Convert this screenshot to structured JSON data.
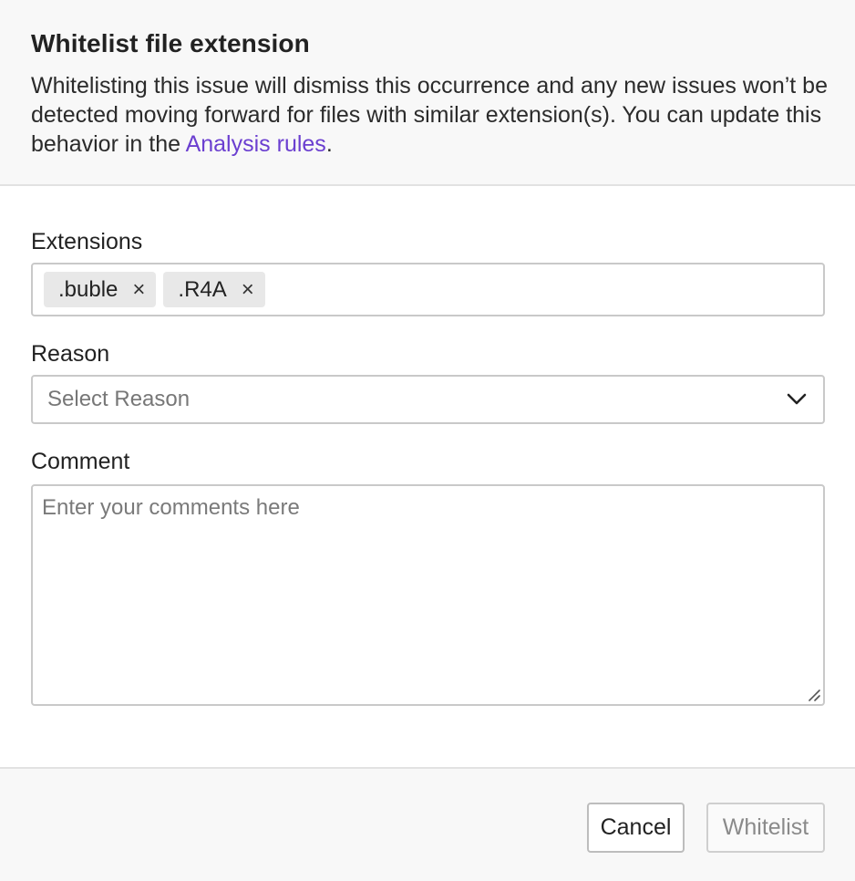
{
  "header": {
    "title": "Whitelist file extension",
    "description_before_link": "Whitelisting this issue will dismiss this occurrence and any new issues won’t be detected moving forward for files with similar extension(s). You can update this behavior in the ",
    "link_text": "Analysis rules",
    "description_after_link": "."
  },
  "extensions": {
    "label": "Extensions",
    "tags": [
      {
        "label": ".buble",
        "remove_glyph": "×"
      },
      {
        "label": ".R4A",
        "remove_glyph": "×"
      }
    ]
  },
  "reason": {
    "label": "Reason",
    "placeholder": "Select Reason",
    "icon": "chevron-down-icon"
  },
  "comment": {
    "label": "Comment",
    "placeholder": "Enter your comments here",
    "value": ""
  },
  "footer": {
    "cancel_label": "Cancel",
    "whitelist_label": "Whitelist"
  },
  "colors": {
    "link": "#6b3fd0",
    "header_bg": "#f8f8f8",
    "border": "#c9c9c9",
    "tag_bg": "#e8e8e8",
    "disabled_text": "#8a8a8a"
  }
}
